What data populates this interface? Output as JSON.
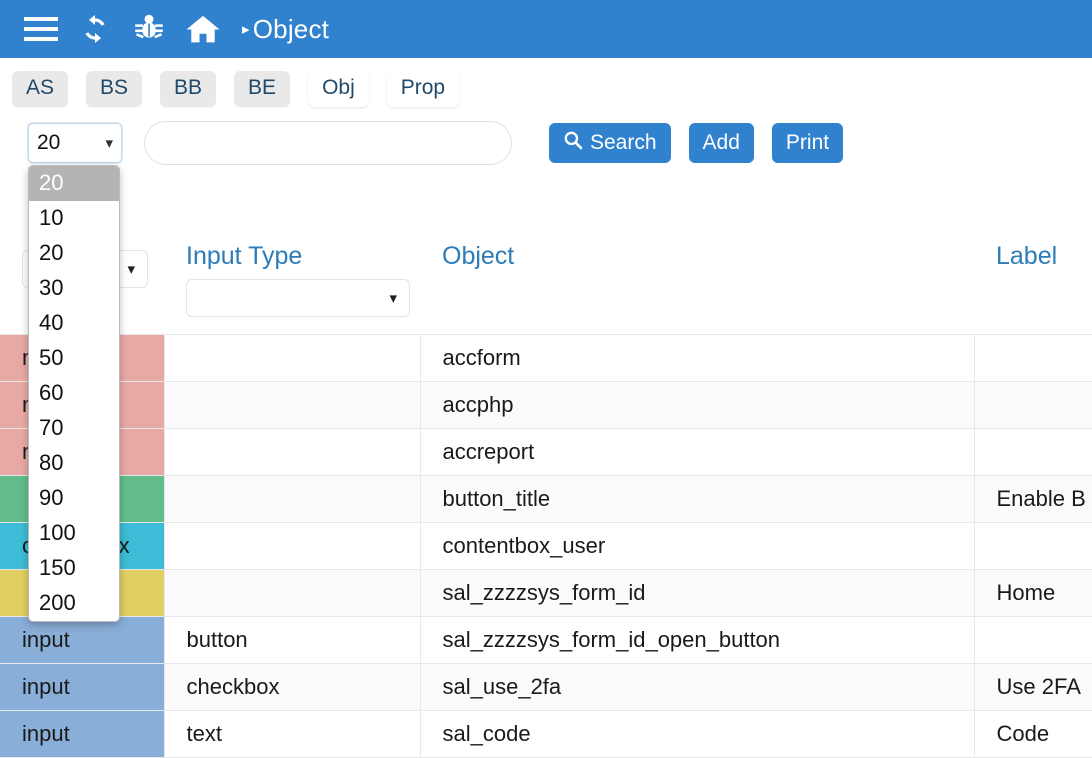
{
  "navbar": {
    "background": "#3182ce",
    "icons": [
      {
        "name": "hamburger-menu-icon",
        "label": "Menu"
      },
      {
        "name": "refresh-icon",
        "label": "Refresh"
      },
      {
        "name": "bug-icon",
        "label": "Debug"
      },
      {
        "name": "home-icon",
        "label": "Home"
      }
    ],
    "breadcrumb_caret": "▸",
    "breadcrumb_title": "Object"
  },
  "tabs": [
    {
      "label": "AS",
      "active": false
    },
    {
      "label": "BS",
      "active": false
    },
    {
      "label": "BB",
      "active": false
    },
    {
      "label": "BE",
      "active": false
    },
    {
      "label": "Obj",
      "active": true
    },
    {
      "label": "Prop",
      "active": true
    }
  ],
  "toolbar": {
    "page_size_value": "20",
    "page_size_options": [
      "10",
      "20",
      "30",
      "40",
      "50",
      "60",
      "70",
      "80",
      "90",
      "100",
      "150",
      "200"
    ],
    "dropdown_open": true,
    "dropdown_highlighted": "20",
    "search_value": "",
    "search_placeholder": "",
    "search_label": "Search",
    "search_icon": "magnifier-icon",
    "add_label": "Add",
    "print_label": "Print",
    "accent_color": "#3182ce"
  },
  "table": {
    "columns": [
      {
        "key": "tag",
        "header": "",
        "has_filter": true,
        "filter_value": ""
      },
      {
        "key": "input_type",
        "header": "Input Type",
        "has_filter": true,
        "filter_value": ""
      },
      {
        "key": "object",
        "header": "Object",
        "has_filter": false,
        "filter_value": ""
      },
      {
        "key": "label",
        "header": "Label",
        "has_filter": false,
        "filter_value": ""
      }
    ],
    "rows": [
      {
        "tag": "main",
        "input_type": "",
        "object": "accform",
        "label": "",
        "color": "#e8a9a4"
      },
      {
        "tag": "main",
        "input_type": "",
        "object": "accphp",
        "label": "",
        "color": "#e8a9a4"
      },
      {
        "tag": "main",
        "input_type": "",
        "object": "accreport",
        "label": "",
        "color": "#e8a9a4"
      },
      {
        "tag": "",
        "input_type": "",
        "object": "button_title",
        "label": "Enable B",
        "color": "#62bd8a"
      },
      {
        "tag": "contentbox",
        "input_type": "",
        "object": "contentbox_user",
        "label": "",
        "color": "#3cbcd6"
      },
      {
        "tag": "",
        "input_type": "",
        "object": "sal_zzzzsys_form_id",
        "label": "Home",
        "color": "#e0d062"
      },
      {
        "tag": "input",
        "input_type": "button",
        "object": "sal_zzzzsys_form_id_open_button",
        "label": "",
        "color": "#89aed8"
      },
      {
        "tag": "input",
        "input_type": "checkbox",
        "object": "sal_use_2fa",
        "label": "Use 2FA",
        "color": "#89aed8"
      },
      {
        "tag": "input",
        "input_type": "text",
        "object": "sal_code",
        "label": "Code",
        "color": "#89aed8"
      }
    ]
  }
}
